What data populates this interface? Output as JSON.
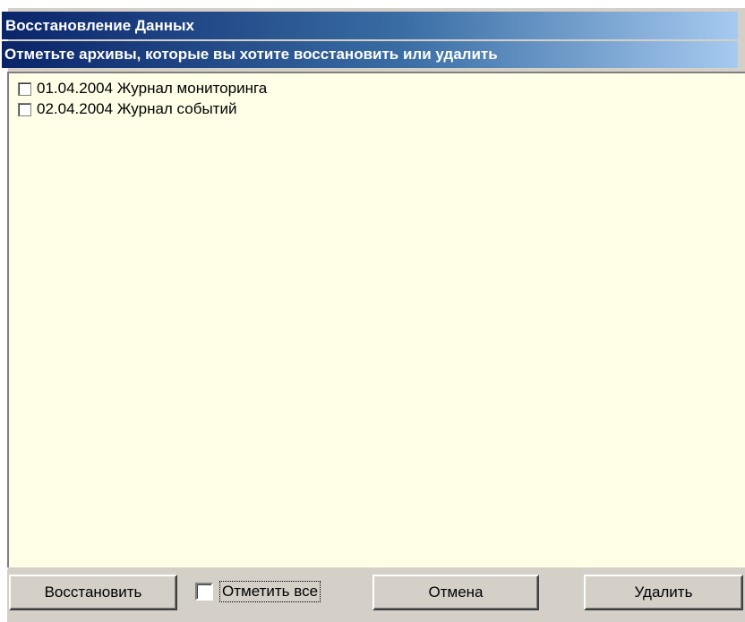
{
  "window": {
    "title": "Восстановление Данных",
    "subtitle": "Отметьте архивы, которые вы хотите восстановить или удалить"
  },
  "archives": [
    {
      "label": "01.04.2004 Журнал мониторинга",
      "checked": false
    },
    {
      "label": "02.04.2004 Журнал событий",
      "checked": false
    }
  ],
  "buttons": {
    "restore": "Восстановить",
    "select_all": "Отметить все",
    "cancel": "Отмена",
    "delete": "Удалить"
  },
  "colors": {
    "title_gradient_start": "#0a246a",
    "title_gradient_end": "#a6caf0",
    "list_background": "#ffffe8",
    "face": "#d4d0c8"
  }
}
